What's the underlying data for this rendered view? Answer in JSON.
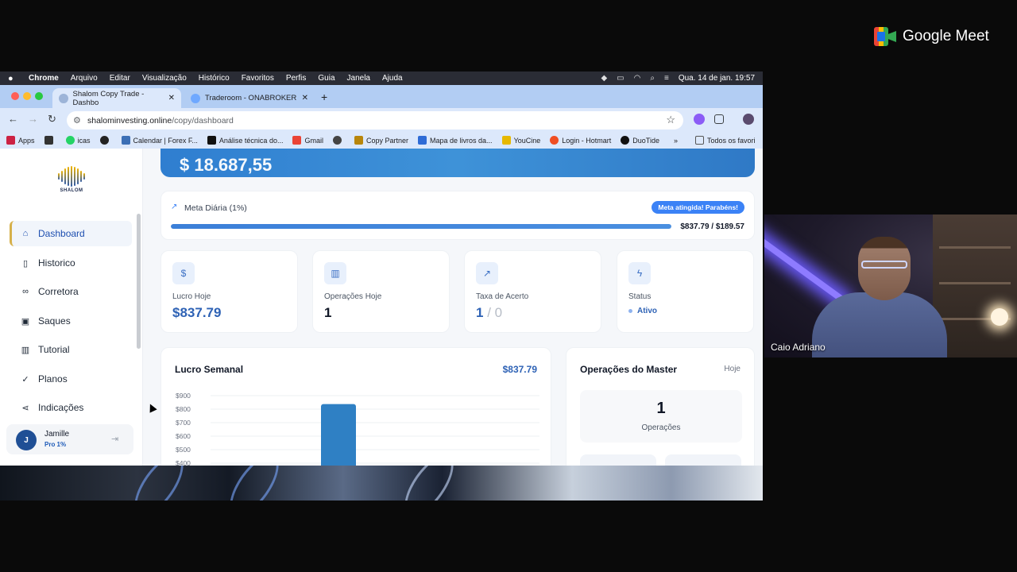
{
  "meet": {
    "brand": "Google Meet",
    "participant_name": "Caio Adriano"
  },
  "menubar": {
    "items": [
      "Chrome",
      "Arquivo",
      "Editar",
      "Visualização",
      "Histórico",
      "Favoritos",
      "Perfis",
      "Guia",
      "Janela",
      "Ajuda"
    ],
    "datetime": "Qua. 14 de jan.  19:57"
  },
  "browser": {
    "tabs": [
      {
        "title": "Shalom Copy Trade - Dashbo",
        "active": true
      },
      {
        "title": "Traderoom - ONABROKER",
        "active": false
      }
    ],
    "url_host": "shalominvesting.online",
    "url_path": "/copy/dashboard",
    "bookmarks": [
      "Apps",
      "icas",
      "Calendar | Forex F...",
      "Análise técnica do...",
      "Gmail",
      "Copy Partner",
      "Mapa de livros da...",
      "YouCine",
      "Login - Hotmart",
      "DuoTide",
      "»",
      "Todos os favori"
    ]
  },
  "sidebar": {
    "logo_text": "SHALOM",
    "items": [
      {
        "label": "Dashboard",
        "icon": "home-icon",
        "active": true
      },
      {
        "label": "Historico",
        "icon": "clipboard-icon",
        "active": false
      },
      {
        "label": "Corretora",
        "icon": "link-icon",
        "active": false
      },
      {
        "label": "Saques",
        "icon": "cash-icon",
        "active": false
      },
      {
        "label": "Tutorial",
        "icon": "book-icon",
        "active": false
      },
      {
        "label": "Planos",
        "icon": "check-circle-icon",
        "active": false
      },
      {
        "label": "Indicações",
        "icon": "share-icon",
        "active": false
      }
    ],
    "user": {
      "initial": "J",
      "name": "Jamille",
      "plan": "Pro 1%"
    }
  },
  "dashboard": {
    "balance_partial": "$ 18.687,55",
    "goal": {
      "title": "Meta Diária (1%)",
      "badge": "Meta atingida! Parabéns!",
      "amount": "$837.79 / $189.57",
      "progress": 1.0
    },
    "stats": [
      {
        "label": "Lucro Hoje",
        "value": "$837.79",
        "icon": "dollar-icon"
      },
      {
        "label": "Operações Hoje",
        "value": "1",
        "icon": "bar-chart-icon"
      },
      {
        "label": "Taxa de Acerto",
        "wins": "1",
        "sep": "/",
        "losses": "0",
        "icon": "trend-up-icon"
      },
      {
        "label": "Status",
        "value": "Ativo",
        "icon": "bolt-icon"
      }
    ],
    "weekly": {
      "title": "Lucro Semanal",
      "total": "$837.79"
    },
    "master": {
      "title": "Operações do Master",
      "period": "Hoje",
      "count": "1",
      "count_label": "Operações"
    }
  },
  "chart_data": {
    "type": "bar",
    "title": "Lucro Semanal",
    "yticks": [
      "$900",
      "$800",
      "$700",
      "$600",
      "$500",
      "$400"
    ],
    "ylim_visible": [
      400,
      900
    ],
    "bars": [
      {
        "index": 3,
        "slots": 9,
        "value": 837.79
      }
    ],
    "color": "#2f80c4"
  }
}
